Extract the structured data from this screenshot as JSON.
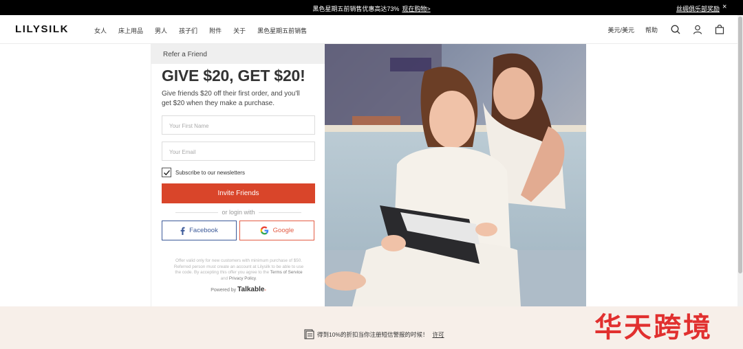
{
  "promo": {
    "text": "黑色星期五前销售优惠高达73%",
    "link": "现在购物>",
    "right_link": "丝绸俱乐部奖励",
    "close": "×"
  },
  "header": {
    "logo": "LILYSILK",
    "nav": [
      "女人",
      "床上用品",
      "男人",
      "孩子们",
      "附件",
      "关于",
      "黑色星期五前销售"
    ],
    "currency": "美元/美元",
    "help": "帮助",
    "icons": [
      "search-icon",
      "user-icon",
      "bag-icon"
    ]
  },
  "referral": {
    "heading": "Refer a Friend",
    "title": "GIVE $20, GET $20!",
    "description": "Give friends $20 off their first order, and you'll get $20 when they make a purchase.",
    "first_name_placeholder": "Your First Name",
    "email_placeholder": "Your Email",
    "subscribe_label": "Subscribe to our newsletters",
    "subscribe_checked": true,
    "invite_button": "Invite Friends",
    "or_login": "or login with",
    "facebook": "Facebook",
    "google": "Google",
    "fine_print": "Offer valid only for new customers with minimum purchase of $50. Referred person must create an account at Lilysilk to be able to use the code. By accepting this offer you agree to the",
    "terms": "Terms of Service",
    "and": "and",
    "privacy": "Privacy Policy",
    "powered_by": "Powered by",
    "powered_brand": "Talkable"
  },
  "bottom": {
    "text": "得到10%的折扣当你注册短信警报的时候！",
    "link": "许可"
  },
  "watermark": "华天跨境",
  "colors": {
    "accent": "#d9452a",
    "facebook": "#3b5998",
    "google": "#e35b43",
    "bottom_bg": "#f7efe9"
  }
}
